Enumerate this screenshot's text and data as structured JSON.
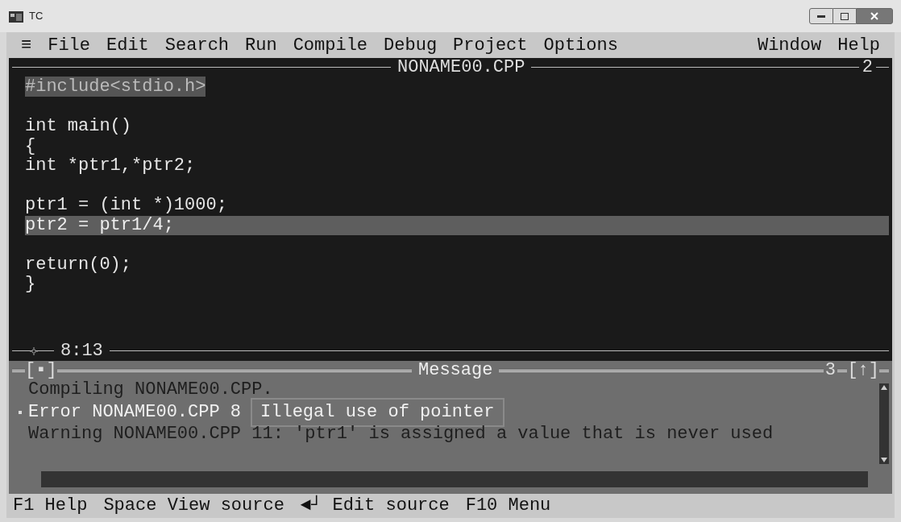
{
  "window": {
    "title": "TC"
  },
  "menu": [
    {
      "label": "≡"
    },
    {
      "label": "File"
    },
    {
      "label": "Edit"
    },
    {
      "label": "Search"
    },
    {
      "label": "Run"
    },
    {
      "label": "Compile"
    },
    {
      "label": "Debug"
    },
    {
      "label": "Project"
    },
    {
      "label": "Options"
    },
    {
      "label": "Window"
    },
    {
      "label": "Help"
    }
  ],
  "editor": {
    "title": "NONAME00.CPP",
    "number": "2",
    "position": "8:13",
    "lines": [
      {
        "kind": "marked",
        "text": "#include<stdio.h>"
      },
      {
        "kind": "blank"
      },
      {
        "kind": "normal",
        "text": "int main()"
      },
      {
        "kind": "normal",
        "text": "{"
      },
      {
        "kind": "normal",
        "text": "int *ptr1,*ptr2;"
      },
      {
        "kind": "blank"
      },
      {
        "kind": "normal",
        "text": "ptr1 = (int *)1000;"
      },
      {
        "kind": "current",
        "text": "ptr2 = ptr1/4;"
      },
      {
        "kind": "blank"
      },
      {
        "kind": "normal",
        "text": "return(0);"
      },
      {
        "kind": "normal",
        "text": "}"
      }
    ]
  },
  "messages": {
    "title": "Message",
    "close": "[▪]",
    "number": "3",
    "zoom": "[↑]",
    "rows": [
      {
        "text": "Compiling NONAME00.CPP.",
        "selected": false
      },
      {
        "text": "Error NONAME00.CPP 8",
        "selected": true
      },
      {
        "text": "Warning NONAME00.CPP 11: 'ptr1' is assigned a value that is never used",
        "selected": false
      }
    ],
    "popup": "Illegal use of pointer"
  },
  "status_bar": [
    {
      "key": "F1",
      "label": "Help"
    },
    {
      "key": "Space",
      "label": "View source"
    },
    {
      "key": "◄┘",
      "label": "Edit source"
    },
    {
      "key": "F10",
      "label": "Menu"
    }
  ]
}
